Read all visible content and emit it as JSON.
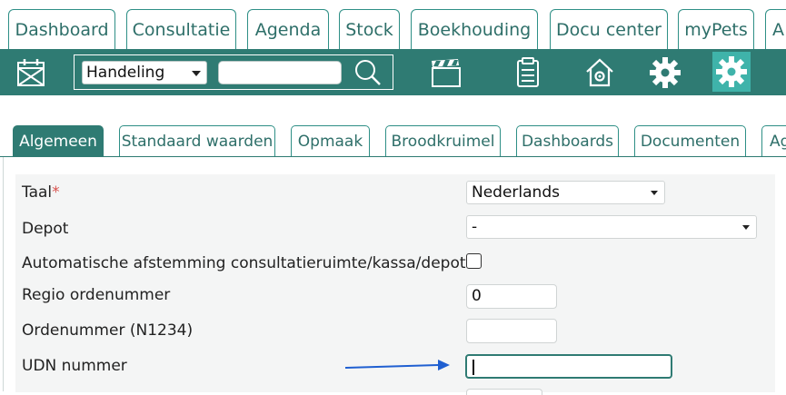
{
  "top_tabs": [
    {
      "label": "Dashboard"
    },
    {
      "label": "Consultatie"
    },
    {
      "label": "Agenda"
    },
    {
      "label": "Stock"
    },
    {
      "label": "Boekhouding"
    },
    {
      "label": "Docu center"
    },
    {
      "label": "myPets"
    },
    {
      "label": "A"
    }
  ],
  "toolbar": {
    "search_type": "Handeling",
    "search_value": "",
    "icons": [
      "calendar-icon",
      "search-icon",
      "clapperboard-icon",
      "clipboard-icon",
      "house-gear-icon",
      "gear-icon",
      "settings-gear-icon"
    ],
    "active_icon": "settings-gear-icon"
  },
  "sub_tabs": [
    {
      "label": "Algemeen",
      "active": true
    },
    {
      "label": "Standaard waarden"
    },
    {
      "label": "Opmaak"
    },
    {
      "label": "Broodkruimel"
    },
    {
      "label": "Dashboards"
    },
    {
      "label": "Documenten"
    },
    {
      "label": "Ag"
    }
  ],
  "form": {
    "taal": {
      "label": "Taal",
      "required": "*",
      "value": "Nederlands"
    },
    "depot": {
      "label": "Depot",
      "value": "-"
    },
    "auto_match": {
      "label": "Automatische afstemming consultatieruimte/kassa/depot",
      "checked": false
    },
    "regio": {
      "label": "Regio ordenummer",
      "value": "0"
    },
    "ordenummer": {
      "label": "Ordenummer (N1234)",
      "value": ""
    },
    "udn": {
      "label": "UDN nummer",
      "value": ""
    }
  },
  "colors": {
    "brand": "#2f7b73",
    "brand_light": "#3fb3aa",
    "tab_text": "#2e6f69",
    "arrow": "#1f5fd1",
    "required": "#d9534f"
  }
}
